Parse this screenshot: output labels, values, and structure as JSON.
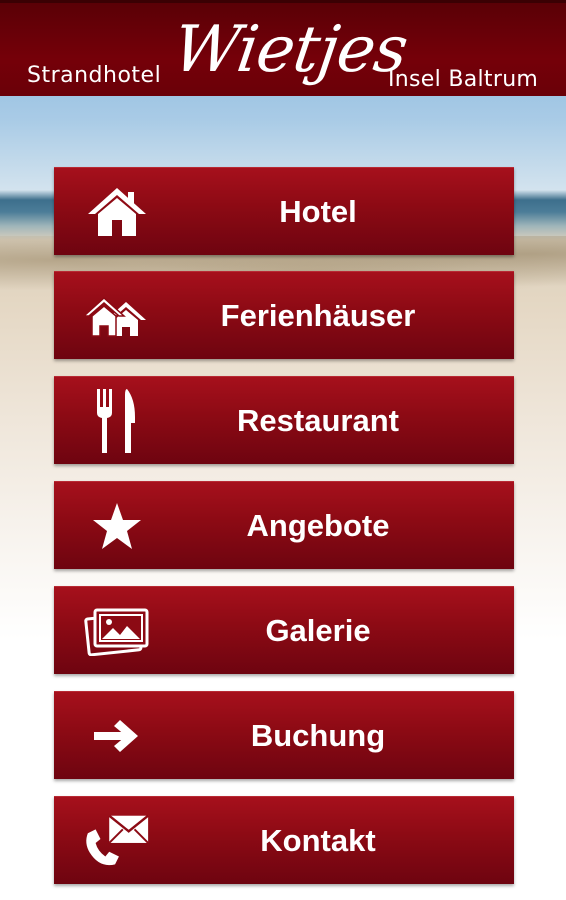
{
  "header": {
    "brand_left": "Strandhotel",
    "logo_text": "Wietjes",
    "brand_right": "Insel Baltrum"
  },
  "colors": {
    "header": "#750009",
    "button": "#8c0a14",
    "text": "#ffffff"
  },
  "menu": {
    "items": [
      {
        "label": "Hotel",
        "icon": "home-icon"
      },
      {
        "label": "Ferienhäuser",
        "icon": "houses-icon"
      },
      {
        "label": "Restaurant",
        "icon": "fork-knife-icon"
      },
      {
        "label": "Angebote",
        "icon": "star-icon"
      },
      {
        "label": "Galerie",
        "icon": "gallery-icon"
      },
      {
        "label": "Buchung",
        "icon": "arrow-right-icon"
      },
      {
        "label": "Kontakt",
        "icon": "phone-mail-icon"
      }
    ]
  }
}
